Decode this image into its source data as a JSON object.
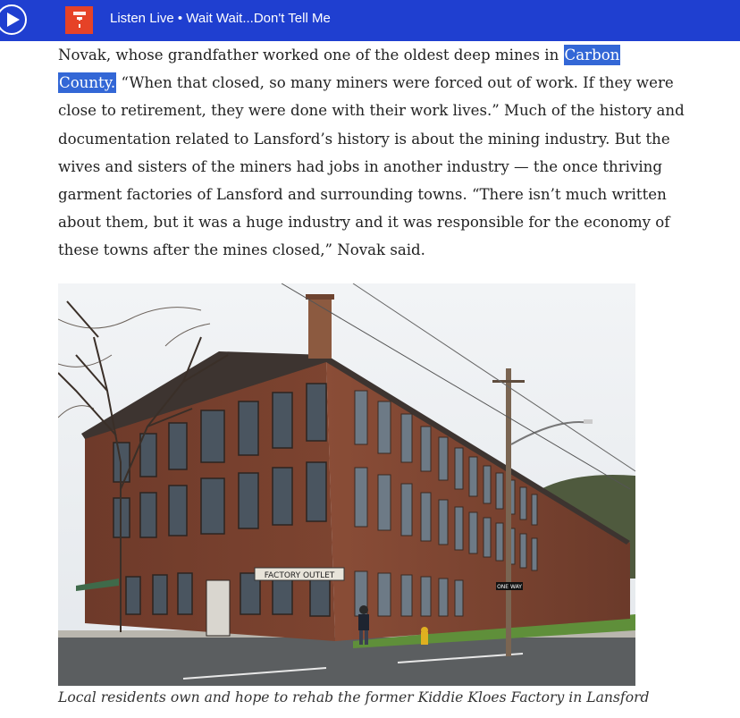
{
  "player": {
    "now_playing": "Listen Live • Wait Wait...Don't Tell Me",
    "play_icon": "play-icon",
    "logo_icon": "station-logo-icon"
  },
  "article": {
    "link_text": "Carbon",
    "link_text_2": "County.",
    "lines": [
      "Novak, whose grandfather worked one of the oldest deep mines in ",
      " “When that closed, so many miners were forced out of work. If they were",
      "close to retirement, they were done with their work lives.” Much of the history and",
      "documentation related to Lansford’s history is about the mining industry. But the",
      "wives and sisters of the miners had jobs in another industry — the once thriving",
      "garment factories of Lansford and surrounding towns. “There isn’t much written",
      "about them, but it was a huge industry and it was responsible for the economy of",
      "these towns after the mines closed,” Novak said."
    ]
  },
  "photo": {
    "sign_text": "FACTORY OUTLET",
    "street_sign": "ONE WAY"
  },
  "caption": "Local residents own and hope to rehab the former Kiddie Kloes Factory in Lansford"
}
